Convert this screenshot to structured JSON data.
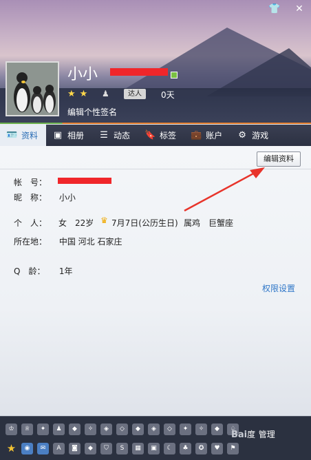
{
  "header": {
    "nickname": "小小",
    "days_label": "0天",
    "daren_label": "达人",
    "signature_label": "编辑个性签名"
  },
  "tabs": [
    {
      "label": "资料",
      "icon": "profile-card-icon"
    },
    {
      "label": "相册",
      "icon": "photo-album-icon"
    },
    {
      "label": "动态",
      "icon": "feed-list-icon"
    },
    {
      "label": "标签",
      "icon": "bookmark-icon"
    },
    {
      "label": "账户",
      "icon": "briefcase-icon"
    },
    {
      "label": "游戏",
      "icon": "game-icon"
    }
  ],
  "profile": {
    "edit_button": "编辑资料",
    "account_label": "帐　号：",
    "nickname_label": "昵　称：",
    "nickname_value": "小小",
    "personal_label": "个　人：",
    "gender": "女",
    "age": "22岁",
    "birthday": "7月7日(公历生日)",
    "zodiac": "属鸡",
    "constellation": "巨蟹座",
    "location_label": "所在地：",
    "location_value": "中国 河北 石家庄",
    "qage_label": "Q　龄：",
    "qage_value": "1年",
    "permission_link": "权限设置"
  },
  "toolbar": {
    "watermark_text": "Bai",
    "watermark_suffix": "度",
    "manage_label": "管理"
  },
  "colors": {
    "accent_red": "#f0262a",
    "link_blue": "#2f77c8",
    "active_tab": "#2a6db5"
  }
}
